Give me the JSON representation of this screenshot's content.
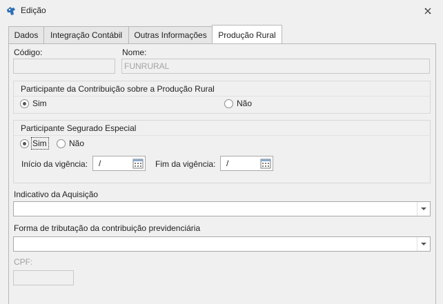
{
  "window": {
    "title": "Edição",
    "close_icon": "close-icon",
    "app_icon": "app-logo-icon"
  },
  "tabs": [
    {
      "label": "Dados"
    },
    {
      "label": "Integração Contábil"
    },
    {
      "label": "Outras Informações"
    },
    {
      "label": "Produção Rural",
      "active": true
    }
  ],
  "form": {
    "codigo_label": "Código:",
    "codigo_value": "",
    "nome_label": "Nome:",
    "nome_value": "FUNRURAL",
    "contribuicao_group": {
      "title": "Participante da Contribuição sobre a Produção Rural",
      "sim_label": "Sim",
      "nao_label": "Não",
      "selected": "Sim"
    },
    "segurado_group": {
      "title": "Participante Segurado Especial",
      "sim_label": "Sim",
      "nao_label": "Não",
      "selected": "Sim",
      "inicio_label": "Início da vigência:",
      "inicio_value": "/",
      "fim_label": "Fim da vigência:",
      "fim_value": "/"
    },
    "indicativo_label": "Indicativo da Aquisição",
    "indicativo_value": "",
    "forma_label": "Forma de tributação da contribuição previdenciária",
    "forma_value": "",
    "cpf_label": "CPF:",
    "cpf_value": ""
  }
}
